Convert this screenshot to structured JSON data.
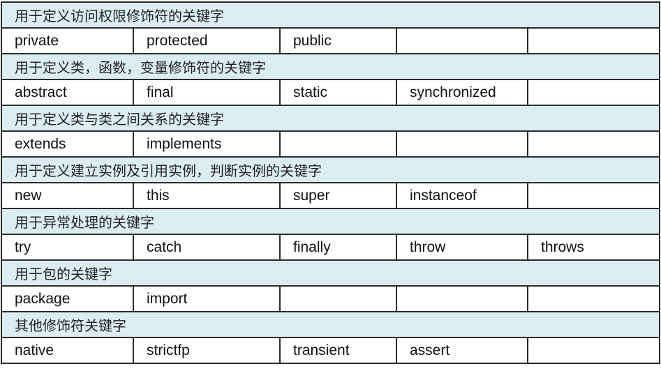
{
  "table": {
    "groups": [
      {
        "category": "用于定义访问权限修饰符的关键字",
        "keywords": [
          "private",
          "protected",
          "public",
          "",
          ""
        ]
      },
      {
        "category": "用于定义类，函数，变量修饰符的关键字",
        "keywords": [
          "abstract",
          "final",
          "static",
          "synchronized",
          ""
        ]
      },
      {
        "category": "用于定义类与类之间关系的关键字",
        "keywords": [
          "extends",
          "implements",
          "",
          "",
          ""
        ]
      },
      {
        "category": "用于定义建立实例及引用实例，判断实例的关键字",
        "keywords": [
          "new",
          "this",
          "super",
          "instanceof",
          ""
        ]
      },
      {
        "category": "用于异常处理的关键字",
        "keywords": [
          "try",
          "catch",
          "finally",
          "throw",
          "throws"
        ]
      },
      {
        "category": "用于包的关键字",
        "keywords": [
          "package",
          "import",
          "",
          "",
          ""
        ]
      },
      {
        "category": "其他修饰符关键字",
        "keywords": [
          "native",
          "strictfp",
          "transient",
          "assert",
          ""
        ]
      }
    ]
  },
  "colors": {
    "category_background": "#dcedf1",
    "border": "#2b2b2b",
    "cell_background": "#ffffff"
  }
}
